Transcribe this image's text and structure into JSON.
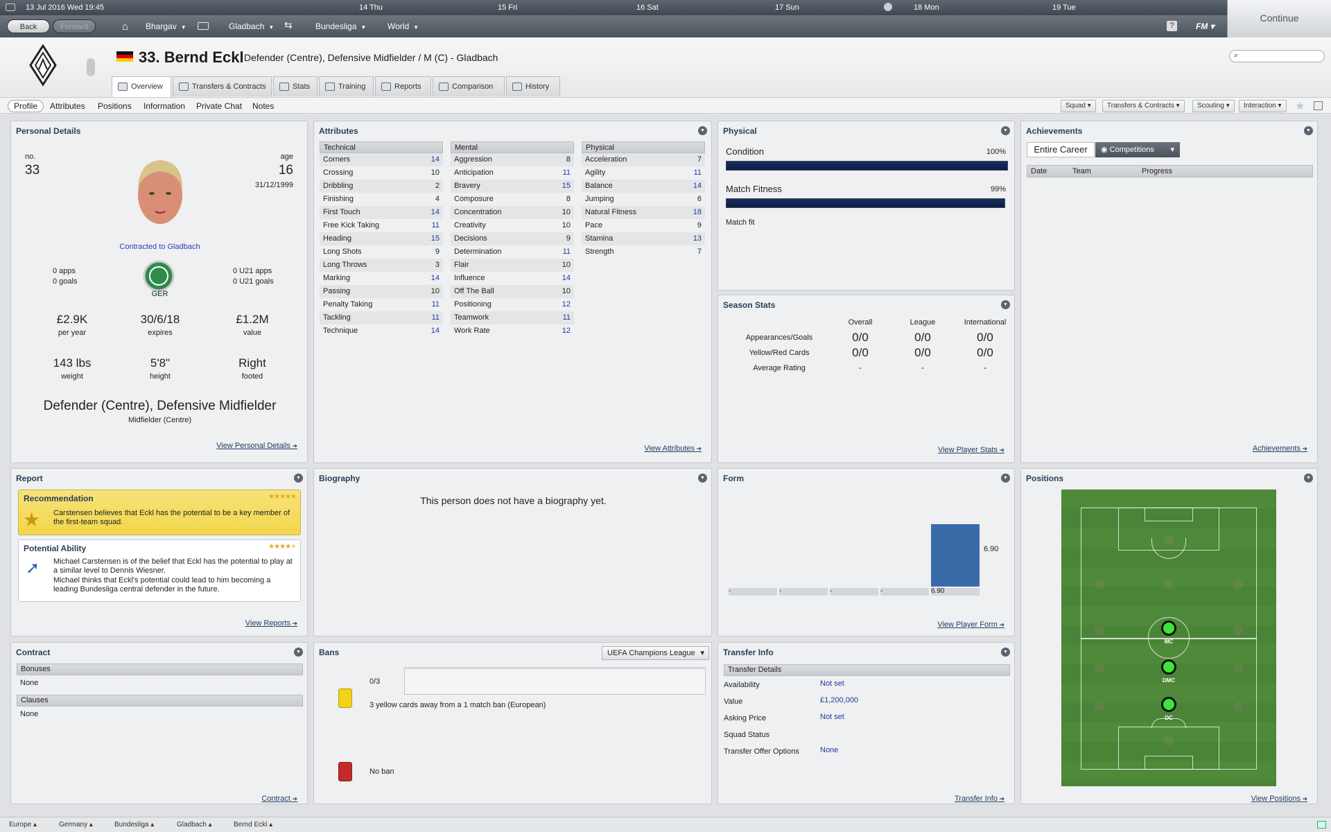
{
  "topbar": {
    "date": "13 Jul 2016 Wed 19:45",
    "days": [
      "14 Thu",
      "15 Fri",
      "16 Sat",
      "17 Sun",
      "18 Mon",
      "19 Tue"
    ],
    "continue_label": "Continue"
  },
  "nav": {
    "back": "Back",
    "forward": "Forward",
    "manager": "Bhargav",
    "club": "Gladbach",
    "league": "Bundesliga",
    "world": "World",
    "fm": "FM"
  },
  "header": {
    "name": "33. Bernd Eckl",
    "subtitle": "Defender (Centre), Defensive Midfielder / M (C) - Gladbach",
    "tabs": [
      "Overview",
      "Transfers & Contracts",
      "Stats",
      "Training",
      "Reports",
      "Comparison",
      "History"
    ]
  },
  "subnav": {
    "items": [
      "Profile",
      "Attributes",
      "Positions",
      "Information",
      "Private Chat",
      "Notes"
    ],
    "dropdowns": [
      "Squad",
      "Transfers & Contracts",
      "Scouting",
      "Interaction"
    ]
  },
  "personal": {
    "title": "Personal Details",
    "no_label": "no.",
    "no": "33",
    "age_label": "age",
    "age": "16",
    "dob": "31/12/1999",
    "contracted": "Contracted to Gladbach",
    "apps": "0 apps",
    "goals": "0 goals",
    "nation": "GER",
    "u21_apps": "0 U21 apps",
    "u21_goals": "0 U21 goals",
    "wage": "£2.9K",
    "wage_label": "per year",
    "expires": "30/6/18",
    "expires_label": "expires",
    "value": "£1.2M",
    "value_label": "value",
    "weight": "143 lbs",
    "weight_label": "weight",
    "height": "5'8\"",
    "height_label": "height",
    "foot": "Right",
    "foot_label": "footed",
    "positions": "Defender (Centre), Defensive Midfielder",
    "positions2": "Midfielder (Centre)",
    "link": "View Personal Details"
  },
  "attributes": {
    "title": "Attributes",
    "technical_label": "Technical",
    "mental_label": "Mental",
    "physical_label": "Physical",
    "technical": [
      {
        "n": "Corners",
        "v": "14"
      },
      {
        "n": "Crossing",
        "v": "10"
      },
      {
        "n": "Dribbling",
        "v": "2"
      },
      {
        "n": "Finishing",
        "v": "4"
      },
      {
        "n": "First Touch",
        "v": "14"
      },
      {
        "n": "Free Kick Taking",
        "v": "11"
      },
      {
        "n": "Heading",
        "v": "15"
      },
      {
        "n": "Long Shots",
        "v": "9"
      },
      {
        "n": "Long Throws",
        "v": "3"
      },
      {
        "n": "Marking",
        "v": "14"
      },
      {
        "n": "Passing",
        "v": "10"
      },
      {
        "n": "Penalty Taking",
        "v": "11"
      },
      {
        "n": "Tackling",
        "v": "11"
      },
      {
        "n": "Technique",
        "v": "14"
      }
    ],
    "mental": [
      {
        "n": "Aggression",
        "v": "8"
      },
      {
        "n": "Anticipation",
        "v": "11"
      },
      {
        "n": "Bravery",
        "v": "15"
      },
      {
        "n": "Composure",
        "v": "8"
      },
      {
        "n": "Concentration",
        "v": "10"
      },
      {
        "n": "Creativity",
        "v": "10"
      },
      {
        "n": "Decisions",
        "v": "9"
      },
      {
        "n": "Determination",
        "v": "11"
      },
      {
        "n": "Flair",
        "v": "10"
      },
      {
        "n": "Influence",
        "v": "14"
      },
      {
        "n": "Off The Ball",
        "v": "10"
      },
      {
        "n": "Positioning",
        "v": "12"
      },
      {
        "n": "Teamwork",
        "v": "11"
      },
      {
        "n": "Work Rate",
        "v": "12"
      }
    ],
    "physical": [
      {
        "n": "Acceleration",
        "v": "7"
      },
      {
        "n": "Agility",
        "v": "11"
      },
      {
        "n": "Balance",
        "v": "14"
      },
      {
        "n": "Jumping",
        "v": "6"
      },
      {
        "n": "Natural Fitness",
        "v": "18"
      },
      {
        "n": "Pace",
        "v": "9"
      },
      {
        "n": "Stamina",
        "v": "13"
      },
      {
        "n": "Strength",
        "v": "7"
      }
    ],
    "link": "View Attributes"
  },
  "physical": {
    "title": "Physical",
    "condition_label": "Condition",
    "condition": "100%",
    "condition_level": 1.0,
    "fitness_label": "Match Fitness",
    "fitness": "99%",
    "fitness_level": 0.99,
    "status": "Match fit"
  },
  "season": {
    "title": "Season Stats",
    "cols": [
      "Overall",
      "League",
      "International"
    ],
    "rows": [
      {
        "label": "Appearances/Goals",
        "vals": [
          "0/0",
          "0/0",
          "0/0"
        ]
      },
      {
        "label": "Yellow/Red Cards",
        "vals": [
          "0/0",
          "0/0",
          "0/0"
        ]
      },
      {
        "label": "Average Rating",
        "vals": [
          "-",
          "-",
          "-"
        ]
      }
    ],
    "link": "View Player Stats"
  },
  "achievements": {
    "title": "Achievements",
    "tab1": "Entire Career",
    "tab2": "Competitions",
    "cols": [
      "Date",
      "Team",
      "Progress"
    ],
    "link": "Achievements"
  },
  "report": {
    "title": "Report",
    "rec_title": "Recommendation",
    "rec_text": "Carstensen believes that Eckl has the potential to be a key member of the first-team squad.",
    "rec_stars": 5,
    "pa_title": "Potential Ability",
    "pa_text1": "Michael Carstensen is of the belief that Eckl has the potential to play at a similar level to Dennis Wiesner.",
    "pa_text2": "Michael thinks that Eckl's potential could lead to him becoming a leading Bundesliga central defender in the future.",
    "pa_stars": 4.5,
    "link": "View Reports"
  },
  "biography": {
    "title": "Biography",
    "text": "This person does not have a biography yet."
  },
  "form": {
    "title": "Form",
    "chart_data": {
      "type": "bar",
      "categories": [
        "-",
        "-",
        "-",
        "-",
        "6.90"
      ],
      "values": [
        0,
        0,
        0,
        0,
        6.9
      ],
      "value_label": "6.90",
      "ylim": [
        0,
        10
      ]
    },
    "link": "View Player Form"
  },
  "positions": {
    "title": "Positions",
    "labels": [
      "MC",
      "DMC",
      "DC"
    ],
    "link": "View Positions"
  },
  "contract": {
    "title": "Contract",
    "bonuses_label": "Bonuses",
    "bonuses": "None",
    "clauses_label": "Clauses",
    "clauses": "None",
    "link": "Contract"
  },
  "bans": {
    "title": "Bans",
    "competition": "UEFA Champions League",
    "yellow_count": "0/3",
    "yellow_text": "3 yellow cards away from a 1 match ban (European)",
    "red_text": "No ban",
    "colors": {
      "yellow": "#f2d21a",
      "red": "#c42a2a"
    }
  },
  "transfer": {
    "title": "Transfer Info",
    "header": "Transfer Details",
    "rows": [
      {
        "label": "Availability",
        "value": "Not set"
      },
      {
        "label": "Value",
        "value": "£1,200,000"
      },
      {
        "label": "Asking Price",
        "value": "Not set"
      },
      {
        "label": "Squad Status",
        "value": ""
      },
      {
        "label": "Transfer Offer Options",
        "value": "None"
      }
    ],
    "link": "Transfer Info"
  },
  "bottom": {
    "crumbs": [
      "Europe",
      "Germany",
      "Bundesliga",
      "Gladbach",
      "Bernd Eckl"
    ]
  },
  "colors": {
    "accent": "#2b3e57",
    "bar": "#3b6aa8",
    "pitch": "#4f8a3b"
  }
}
